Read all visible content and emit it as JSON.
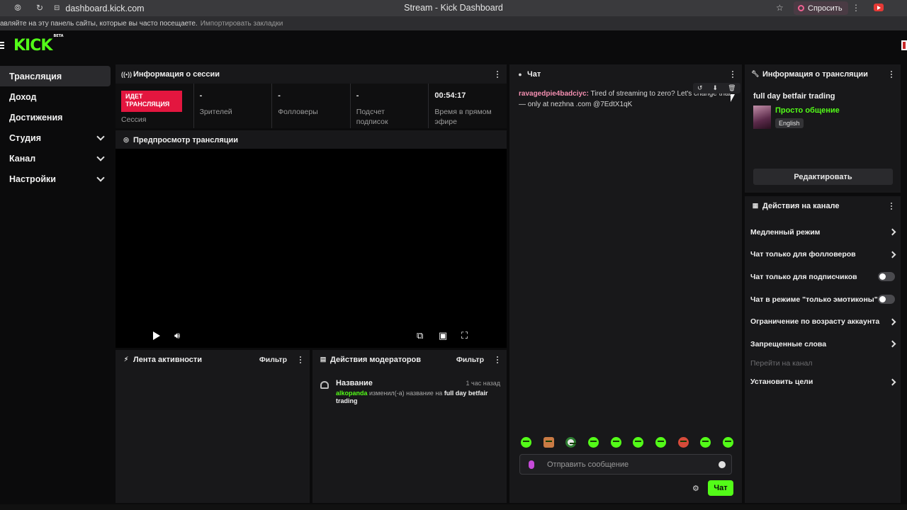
{
  "browser": {
    "url": "dashboard.kick.com",
    "title": "Stream - Kick Dashboard",
    "ask_label": "Спросить",
    "bookmarks_text": "авляйте на эту панель сайты, которые вы часто посещаете.",
    "import_label": "Импортировать закладки"
  },
  "brand": {
    "logo": "KICK",
    "badge": "BETA",
    "accent": "#53fc18"
  },
  "sidebar": {
    "items": [
      {
        "label": "Трансляция"
      },
      {
        "label": "Доход"
      },
      {
        "label": "Достижения"
      },
      {
        "label": "Студия"
      },
      {
        "label": "Канал"
      },
      {
        "label": "Настройки"
      }
    ]
  },
  "session": {
    "title": "Информация о сессии",
    "live_badge": "ИДЕТ ТРАНСЛЯЦИЯ",
    "session_label": "Сессия",
    "viewers_value": "-",
    "viewers_label": "Зрителей",
    "followers_value": "-",
    "followers_label": "Фолловеры",
    "subs_value": "-",
    "subs_label": "Подсчет подписок",
    "uptime_value": "00:54:17",
    "uptime_label": "Время в прямом эфире"
  },
  "preview": {
    "title": "Предпросмотр трансляции"
  },
  "activity": {
    "title": "Лента активности",
    "filter": "Фильтр"
  },
  "mod_actions": {
    "title": "Действия модераторов",
    "filter": "Фильтр",
    "entry": {
      "title": "Название",
      "time": "1 час назад",
      "user": "alkopanda",
      "action": "изменил(-а) название на",
      "value": "full day betfair trading"
    }
  },
  "chat": {
    "title": "Чат",
    "message": {
      "user": "ravagedpie4badciyc:",
      "text": "Tired of streaming to zero? Let's change that — only at nezhna .com @7EdtX1qK"
    },
    "input_placeholder": "Отправить сообщение",
    "send_label": "Чат"
  },
  "stream_info": {
    "title": "Информация о трансляции",
    "stream_title": "full day betfair trading",
    "category": "Просто общение",
    "language": "English",
    "edit_label": "Редактировать"
  },
  "channel_actions": {
    "title": "Действия на канале",
    "items": [
      {
        "label": "Медленный режим",
        "control": "arrow"
      },
      {
        "label": "Чат только для фолловеров",
        "control": "arrow"
      },
      {
        "label": "Чат только для подписчиков",
        "control": "toggle"
      },
      {
        "label": "Чат в режиме \"только эмотиконы\"",
        "control": "toggle"
      },
      {
        "label": "Ограничение по возрасту аккаунта",
        "control": "arrow"
      },
      {
        "label": "Запрещенные слова",
        "control": "arrow"
      },
      {
        "label": "Перейти на канал",
        "control": "none"
      },
      {
        "label": "Установить цели",
        "control": "arrow"
      }
    ]
  }
}
